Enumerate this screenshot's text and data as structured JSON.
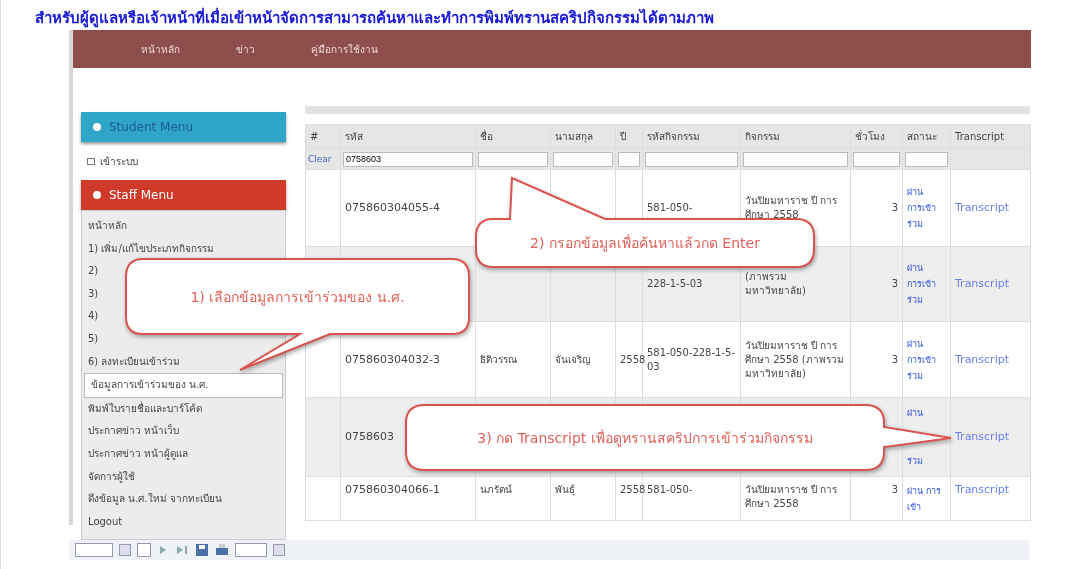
{
  "heading": "สำหรับผู้ดูแลหรือเจ้าหน้าที่เมื่อเข้าหน้าจัดการสามารถค้นหาและทำการพิมพ์ทรานสคริปกิจกรรมได้ตามภาพ",
  "nav": [
    {
      "label": "หน้าหลัก"
    },
    {
      "label": "ข่าว"
    },
    {
      "label": "คู่มือการใช้งาน"
    }
  ],
  "student_menu": {
    "title": "Student Menu",
    "items": [
      {
        "label": "เข้าระบบ"
      }
    ]
  },
  "staff_menu": {
    "title": "Staff Menu",
    "items": [
      {
        "label": "หน้าหลัก",
        "selected": false
      },
      {
        "label": "1) เพิ่ม/แก้ไขประเภทกิจกรรม",
        "selected": false
      },
      {
        "label": "2)",
        "selected": false
      },
      {
        "label": "3)",
        "selected": false
      },
      {
        "label": "4)",
        "selected": false
      },
      {
        "label": "5)",
        "selected": false
      },
      {
        "label": "6) ลงทะเบียนเข้าร่วม",
        "selected": false
      },
      {
        "label": "ข้อมูลการเข้าร่วมของ น.ศ.",
        "selected": true
      },
      {
        "label": "พิมพ์ใบรายชื่อและบาร์โค้ด",
        "selected": false
      },
      {
        "label": "ประกาศข่าว หน้าเว็บ",
        "selected": false
      },
      {
        "label": "ประกาศข่าว หน้าผู้ดูแล",
        "selected": false
      },
      {
        "label": "จัดการผู้ใช้",
        "selected": false
      },
      {
        "label": "ดึงข้อมูล น.ศ.ใหม่ จากทะเบียน",
        "selected": false
      },
      {
        "label": "Logout",
        "selected": false
      }
    ]
  },
  "table": {
    "columns": [
      "#",
      "รหัส",
      "ชื่อ",
      "นามสกุล",
      "ปี",
      "รหัสกิจกรรม",
      "กิจกรรม",
      "ชั่วโมง",
      "สถานะ",
      "Transcript"
    ],
    "filter": {
      "clear": "Clear",
      "id_value": "0758603"
    },
    "rows": [
      {
        "id": "075860304055-4",
        "activity_code": "581-050-",
        "activity": "วันปิยมหาราช ปี การศึกษา 2558",
        "hours": "3",
        "status": [
          "ผ่าน",
          "การเข้า",
          "ร่วม"
        ],
        "link": "Transcript"
      },
      {
        "activity_code": "228-1-5-03",
        "activity": "(ภาพรวม มหาวิทยาลัย)",
        "hours": "3",
        "status": [
          "ผ่าน",
          "การเข้า",
          "ร่วม"
        ],
        "link": "Transcript"
      },
      {
        "id": "075860304032-3",
        "first_name": "ธิติวรรณ",
        "last_name": "จันเจริญ",
        "year": "2558",
        "activity_code": "581-050-228-1-5-03",
        "activity": "วันปิยมหาราช ปี การศึกษา 2558 (ภาพรวม มหาวิทยาลัย)",
        "hours": "3",
        "status": [
          "ผ่าน",
          "การเข้า",
          "ร่วม"
        ],
        "link": "Transcript"
      },
      {
        "id": "0758603",
        "status": [
          "ผ่าน",
          "ร่วม"
        ],
        "link": "Transcript"
      },
      {
        "id": "075860304066-1",
        "first_name": "นภรัตน์",
        "last_name": "พันธุ์",
        "year": "2558",
        "activity_code": "581-050-",
        "activity": "วันปิยมหาราช ปี การศึกษา 2558",
        "hours": "3",
        "status": [
          "ผ่าน การเข้า"
        ],
        "link": "Transcript"
      }
    ]
  },
  "callouts": [
    {
      "text": "1) เลือกข้อมูลการเข้าร่วมของ น.ศ."
    },
    {
      "text": "2) กรอกข้อมูลเพื่อค้นหาแล้วกด Enter"
    },
    {
      "text": "3) กด Transcript เพื่อดูทรานสคริปการเข้าร่วมกิจกรรม"
    }
  ]
}
